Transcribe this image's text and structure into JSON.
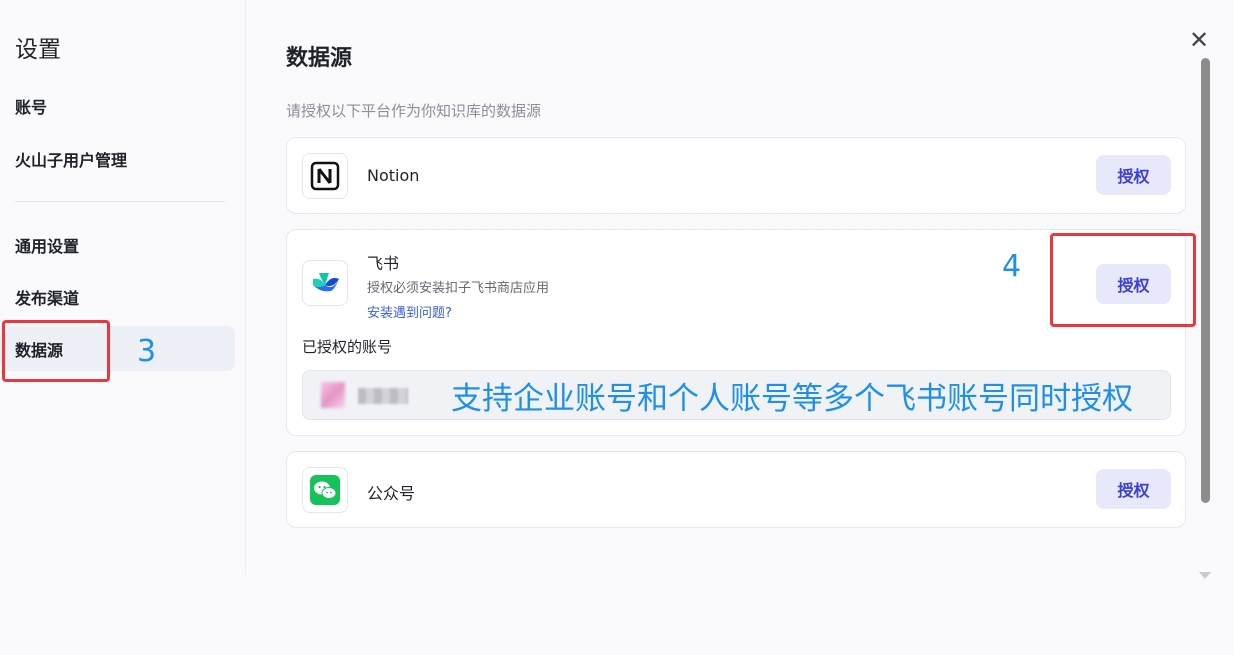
{
  "sidebar": {
    "title": "设置",
    "items": [
      {
        "label": "账号"
      },
      {
        "label": "火山子用户管理"
      },
      {
        "label": "通用设置"
      },
      {
        "label": "发布渠道"
      },
      {
        "label": "数据源"
      }
    ]
  },
  "main": {
    "title": "数据源",
    "description": "请授权以下平台作为你知识库的数据源",
    "sources": [
      {
        "name": "Notion",
        "button": "授权",
        "icon": "notion-icon"
      },
      {
        "name": "飞书",
        "subtitle": "授权必须安装扣子飞书商店应用",
        "help_link": "安装遇到问题?",
        "button": "授权",
        "icon": "feishu-icon",
        "authorized_label": "已授权的账号"
      },
      {
        "name": "公众号",
        "button": "授权",
        "icon": "wechat-icon"
      }
    ]
  },
  "annotations": {
    "step3": "3",
    "step4": "4",
    "note": "支持企业账号和个人账号等多个飞书账号同时授权"
  },
  "colors": {
    "accent": "#3b3fd6",
    "button_bg": "#e8e8fb",
    "annotation_blue": "#1e90ea",
    "annotation_red": "#e8383d"
  }
}
